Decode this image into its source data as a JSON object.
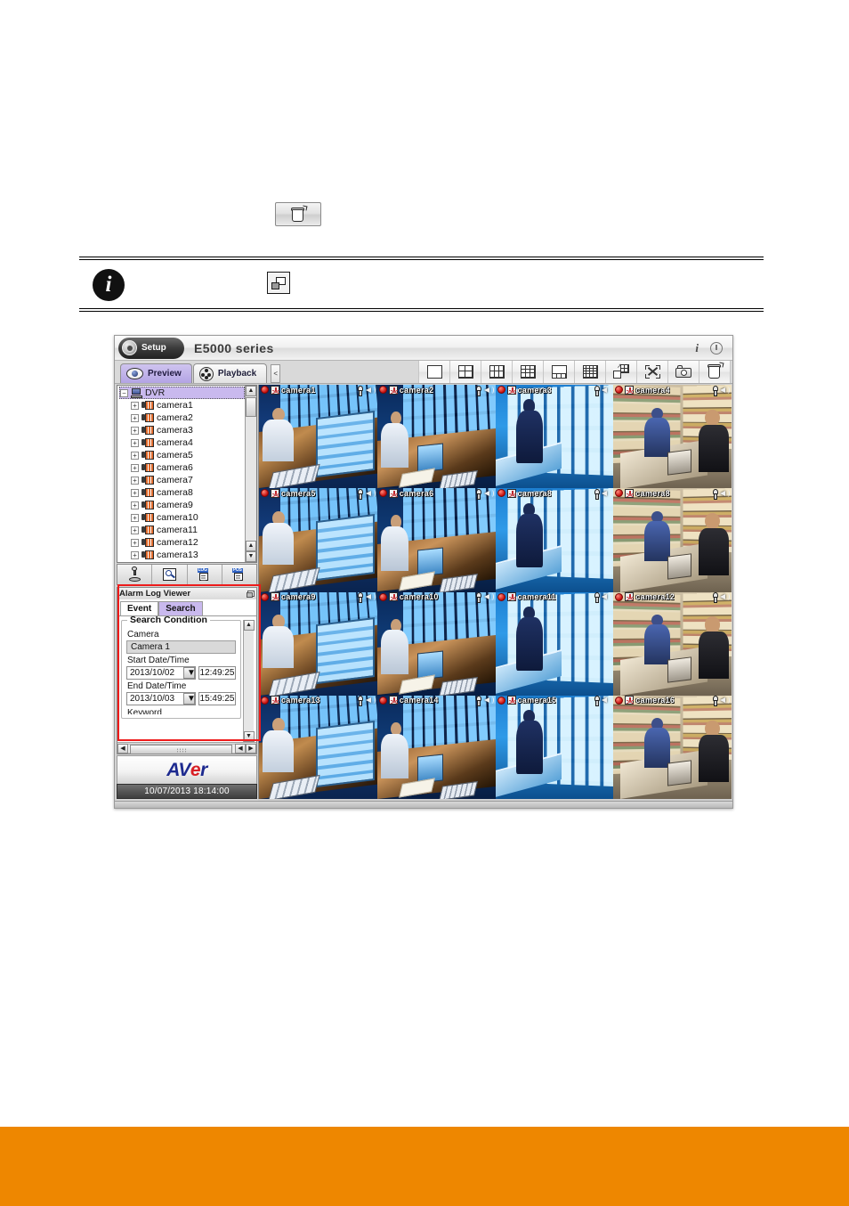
{
  "document": {
    "icon_button": {
      "name": "trash-icon-button",
      "glyph": "trash-can"
    },
    "note": {
      "icon": "info-circle-icon",
      "inline_icon": "cascade-windows-icon"
    }
  },
  "window": {
    "setup_label": "Setup",
    "title": "E5000 series",
    "title_icons": [
      {
        "name": "info-icon",
        "glyph": "i"
      },
      {
        "name": "power-icon",
        "glyph": "power"
      }
    ]
  },
  "tabs": [
    {
      "label": "Preview",
      "icon": "eye-icon",
      "active": true
    },
    {
      "label": "Playback",
      "icon": "film-reel-icon",
      "active": false
    }
  ],
  "collapse_button_label": "<",
  "toolbar": {
    "buttons": [
      {
        "name": "split-1-button",
        "icon": "split-1-icon"
      },
      {
        "name": "split-4-button",
        "icon": "split-4-icon"
      },
      {
        "name": "split-6-button",
        "icon": "split-6-icon"
      },
      {
        "name": "split-9-button",
        "icon": "split-9-icon"
      },
      {
        "name": "split-1plus5-button",
        "icon": "split-1plus5-icon"
      },
      {
        "name": "split-16-button",
        "icon": "split-16-icon"
      },
      {
        "name": "custom-layout-button",
        "icon": "custom-layout-icon"
      },
      {
        "name": "fullscreen-button",
        "icon": "fullscreen-icon"
      },
      {
        "name": "snapshot-button",
        "icon": "camera-icon"
      },
      {
        "name": "exit-button",
        "icon": "trash-icon"
      }
    ]
  },
  "tree": {
    "root": {
      "label": "DVR",
      "icon": "dvr-icon"
    },
    "nodes": [
      {
        "label": "camera1"
      },
      {
        "label": "camera2"
      },
      {
        "label": "camera3"
      },
      {
        "label": "camera4"
      },
      {
        "label": "camera5"
      },
      {
        "label": "camera6"
      },
      {
        "label": "camera7"
      },
      {
        "label": "camera8"
      },
      {
        "label": "camera9"
      },
      {
        "label": "camera10"
      },
      {
        "label": "camera11"
      },
      {
        "label": "camera12"
      },
      {
        "label": "camera13"
      }
    ],
    "tools": [
      {
        "name": "ptz-button",
        "icon": "joystick-icon"
      },
      {
        "name": "search-button",
        "icon": "find-page-icon"
      },
      {
        "name": "log-button",
        "icon": "log-icon",
        "tag": "LOG"
      },
      {
        "name": "pos-button",
        "icon": "pos-icon",
        "tag": "POS"
      }
    ]
  },
  "alarm_panel": {
    "title": "Alarm Log Viewer",
    "dock_icon": "undock-icon",
    "tabs": [
      {
        "label": "Event",
        "active": false
      },
      {
        "label": "Search",
        "active": true
      }
    ],
    "group_title": "Search Condition",
    "fields": {
      "camera_label": "Camera",
      "camera_value": "Camera 1",
      "start_label": "Start Date/Time",
      "start_date": "2013/10/02",
      "start_time": "12:49:25",
      "end_label": "End Date/Time",
      "end_date": "2013/10/03",
      "end_time": "15:49:25",
      "keyword_label": "Keyword"
    },
    "highlight_color": "#ee1b1b"
  },
  "branding": {
    "logo_part1": "AV",
    "logo_part2": "e",
    "logo_part3": "r",
    "logo_blue": "#1d2a8f",
    "logo_red": "#d81f26",
    "clock": "10/07/2013 18:14:00"
  },
  "video_grid": {
    "columns": 4,
    "rows": 4,
    "selected_index": 0,
    "cells": [
      {
        "name": "camera1",
        "scene": "a"
      },
      {
        "name": "camera2",
        "scene": "b"
      },
      {
        "name": "camera3",
        "scene": "c"
      },
      {
        "name": "camera4",
        "scene": "d"
      },
      {
        "name": "camera5",
        "scene": "a"
      },
      {
        "name": "camera6",
        "scene": "b"
      },
      {
        "name": "camera8",
        "scene": "c"
      },
      {
        "name": "camera8",
        "scene": "d"
      },
      {
        "name": "camera9",
        "scene": "a"
      },
      {
        "name": "camera10",
        "scene": "b"
      },
      {
        "name": "camera11",
        "scene": "c"
      },
      {
        "name": "camera12",
        "scene": "d"
      },
      {
        "name": "camera13",
        "scene": "a"
      },
      {
        "name": "camera14",
        "scene": "b"
      },
      {
        "name": "camera15",
        "scene": "c"
      },
      {
        "name": "camera16",
        "scene": "d"
      }
    ]
  },
  "footer": {
    "color": "#ee8700"
  }
}
